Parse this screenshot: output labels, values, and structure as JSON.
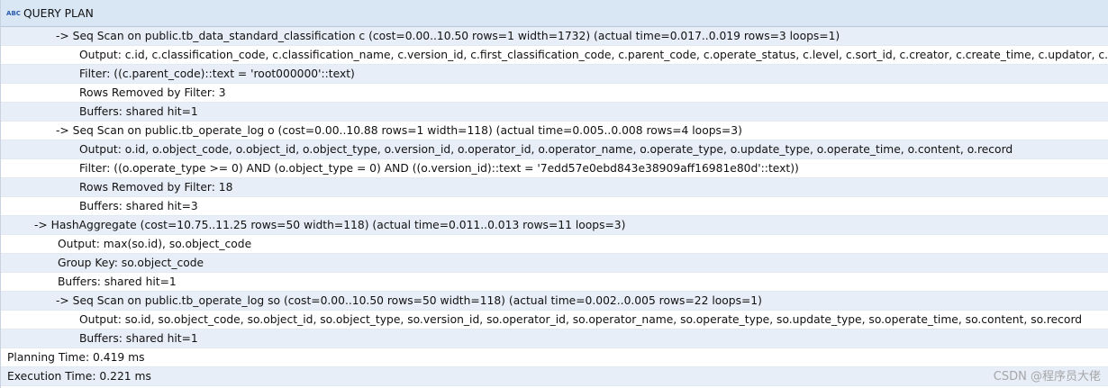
{
  "header": {
    "icon": "abc-text-icon",
    "icon_text": "ABC",
    "title": "QUERY PLAN"
  },
  "rows": [
    "->  Seq Scan on public.tb_data_standard_classification c  (cost=0.00..10.50 rows=1 width=1732) (actual time=0.017..0.019 rows=3 loops=1)",
    "Output: c.id, c.classification_code, c.classification_name, c.version_id, c.first_classification_code, c.parent_code, c.operate_status, c.level, c.sort_id, c.creator, c.create_time, c.updator, c.update_time, c.up",
    "Filter: ((c.parent_code)::text = 'root000000'::text)",
    "Rows Removed by Filter: 3",
    "Buffers: shared hit=1",
    "->  Seq Scan on public.tb_operate_log o  (cost=0.00..10.88 rows=1 width=118) (actual time=0.005..0.008 rows=4 loops=3)",
    "Output: o.id, o.object_code, o.object_id, o.object_type, o.version_id, o.operator_id, o.operator_name, o.operate_type, o.update_type, o.operate_time, o.content, o.record",
    "Filter: ((o.operate_type >= 0) AND (o.object_type = 0) AND ((o.version_id)::text = '7edd57e0ebd843e38909aff16981e80d'::text))",
    "Rows Removed by Filter: 18",
    "Buffers: shared hit=3",
    "->  HashAggregate  (cost=10.75..11.25 rows=50 width=118) (actual time=0.011..0.013 rows=11 loops=3)",
    "Output: max(so.id), so.object_code",
    "Group Key: so.object_code",
    "Buffers: shared hit=1",
    "->  Seq Scan on public.tb_operate_log so  (cost=0.00..10.50 rows=50 width=118) (actual time=0.002..0.005 rows=22 loops=1)",
    "Output: so.id, so.object_code, so.object_id, so.object_type, so.version_id, so.operator_id, so.operator_name, so.operate_type, so.update_type, so.operate_time, so.content, so.record",
    "Buffers: shared hit=1",
    "Planning Time: 0.419 ms",
    "Execution Time: 0.221 ms"
  ],
  "watermark": "CSDN @程序员大佬",
  "colors": {
    "header_bg": "#d9e6f4",
    "row_alt_bg": "#e8eef7",
    "icon": "#2a5db0"
  }
}
